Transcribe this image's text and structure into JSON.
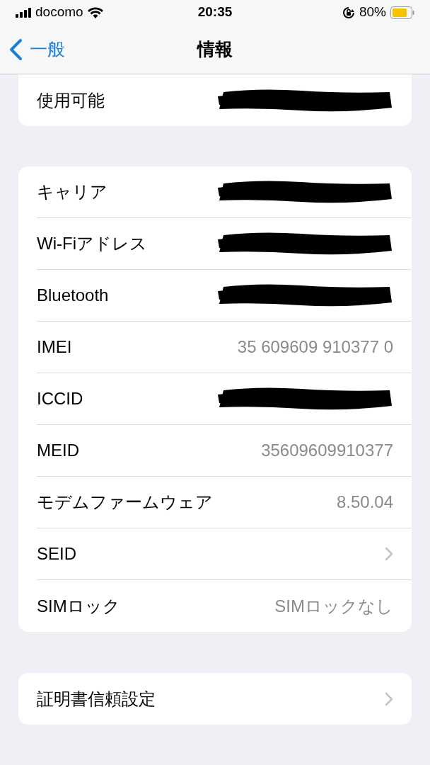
{
  "status_bar": {
    "carrier": "docomo",
    "time": "20:35",
    "battery": "80%"
  },
  "nav": {
    "back": "一般",
    "title": "情報"
  },
  "groups": [
    {
      "cut_top": true,
      "rows": [
        {
          "kind": "redacted",
          "label": "使用可能"
        }
      ]
    },
    {
      "cut_top": false,
      "rows": [
        {
          "kind": "redacted",
          "label": "キャリア"
        },
        {
          "kind": "redacted",
          "label": "Wi-Fiアドレス"
        },
        {
          "kind": "redacted",
          "label": "Bluetooth"
        },
        {
          "kind": "value",
          "label": "IMEI",
          "value": "35 609609 910377 0"
        },
        {
          "kind": "redacted",
          "label": "ICCID"
        },
        {
          "kind": "value",
          "label": "MEID",
          "value": "35609609910377"
        },
        {
          "kind": "value",
          "label": "モデムファームウェア",
          "value": "8.50.04"
        },
        {
          "kind": "link",
          "label": "SEID"
        },
        {
          "kind": "value",
          "label": "SIMロック",
          "value": "SIMロックなし"
        }
      ]
    },
    {
      "cut_top": false,
      "rows": [
        {
          "kind": "link",
          "label": "証明書信頼設定"
        }
      ]
    }
  ]
}
